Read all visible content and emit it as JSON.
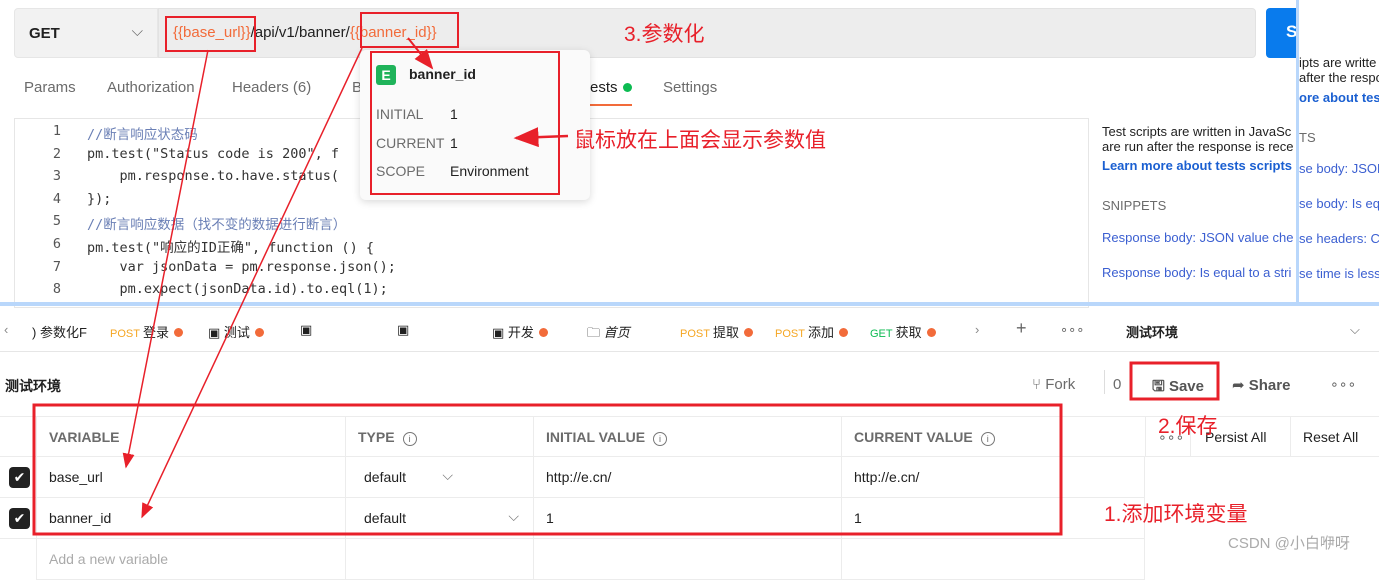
{
  "request": {
    "method": "GET",
    "url_parts": [
      "{{base_url}}",
      "/api/v1/banner/",
      "{{banner_id}}"
    ],
    "send_label": "S"
  },
  "tabs": [
    {
      "label": "Params"
    },
    {
      "label": "Authorization"
    },
    {
      "label": "Headers (6)"
    },
    {
      "label": "B"
    },
    {
      "label": "ests"
    },
    {
      "label": "Settings"
    }
  ],
  "editor": {
    "lines": [
      {
        "n": "1",
        "html": "cm",
        "text": "//断言响应状态码"
      },
      {
        "n": "2",
        "text": "pm.test(\"Status code is 200\", f"
      },
      {
        "n": "3",
        "text": "    pm.response.to.have.status("
      },
      {
        "n": "4",
        "text": "});"
      },
      {
        "n": "5",
        "text": "//断言响应数据（找不变的数据进行断言）"
      },
      {
        "n": "6",
        "text": "pm.test(\"响应的ID正确\", function () {"
      },
      {
        "n": "7",
        "text": "    var jsonData = pm.response.json();"
      },
      {
        "n": "8",
        "text": "    pm.expect(jsonData.id).to.eql(1);"
      }
    ]
  },
  "right_panel": {
    "intro1": "Test scripts are written in JavaSc",
    "intro2": "are run after the response is rece",
    "learn_more": "Learn more about tests scripts",
    "snippets_title": "SNIPPETS",
    "snippets": [
      "Response body: JSON value che",
      "Response body: Is equal to a stri"
    ]
  },
  "overlay_panel": {
    "line1": "ipts are writte",
    "line2": "after the respo",
    "link": "ore about tes",
    "title": "TS",
    "items": [
      "se body: JSON",
      "se body: Is eq",
      "se headers: Co",
      "se time is less"
    ]
  },
  "tooltip": {
    "badge": "E",
    "name": "banner_id",
    "rows": [
      {
        "k": "INITIAL",
        "v": "1"
      },
      {
        "k": "CURRENT",
        "v": "1"
      },
      {
        "k": "SCOPE",
        "v": "Environment"
      }
    ]
  },
  "tab_bar": {
    "items": [
      {
        "label": "参数化F"
      },
      {
        "method": "POST",
        "label": "登录"
      },
      {
        "label": "测试"
      },
      {
        "label": ""
      },
      {
        "label": ""
      },
      {
        "label": "开发"
      },
      {
        "label": "首页"
      },
      {
        "method": "POST",
        "label": "提取"
      },
      {
        "method": "POST",
        "label": "添加"
      },
      {
        "method": "GET",
        "label": "获取"
      }
    ],
    "environment": "测试环境"
  },
  "environment": {
    "title": "测试环境",
    "fork": "Fork",
    "fork_count": "0",
    "save": "Save",
    "share": "Share",
    "persist_all": "Persist All",
    "reset_all": "Reset All",
    "headers": [
      "VARIABLE",
      "TYPE",
      "INITIAL VALUE",
      "CURRENT VALUE"
    ],
    "rows": [
      {
        "checked": true,
        "variable": "base_url",
        "type": "default",
        "initial": "http://e.cn/",
        "current": "http://e.cn/"
      },
      {
        "checked": true,
        "variable": "banner_id",
        "type": "default",
        "initial": "1",
        "current": "1"
      }
    ],
    "add_placeholder": "Add a new variable"
  },
  "annotations": {
    "a1": "1.添加环境变量",
    "a2": "2.保存",
    "a3": "3.参数化",
    "a4": "鼠标放在上面会显示参数值"
  },
  "watermark": "CSDN @小白咿呀",
  "colors": {
    "accent": "#f26b3a",
    "send": "#097bed",
    "annotation": "#e8202a",
    "env_badge": "#1fb35a"
  }
}
